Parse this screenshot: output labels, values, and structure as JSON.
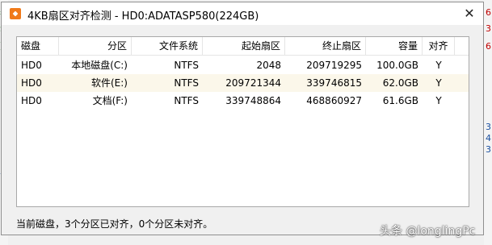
{
  "window": {
    "title": "4KB扇区对齐检测 - HD0:ADATASP580(224GB)",
    "close_glyph": "✕"
  },
  "table": {
    "columns": [
      "磁盘",
      "分区",
      "文件系统",
      "起始扇区",
      "终止扇区",
      "容量",
      "对齐"
    ],
    "rows": [
      [
        "HD0",
        "本地磁盘(C:)",
        "NTFS",
        "2048",
        "209719295",
        "100.0GB",
        "Y"
      ],
      [
        "HD0",
        "软件(E:)",
        "NTFS",
        "209721344",
        "339746815",
        "62.0GB",
        "Y"
      ],
      [
        "HD0",
        "文档(F:)",
        "NTFS",
        "339748864",
        "468860927",
        "61.6GB",
        "Y"
      ]
    ]
  },
  "status": "当前磁盘，3个分区已对齐，0个分区未对齐。",
  "watermark": "头条 @longlingPc",
  "colors": {
    "selected_row": "#fbf7ea",
    "icon": "#f07a1a"
  }
}
